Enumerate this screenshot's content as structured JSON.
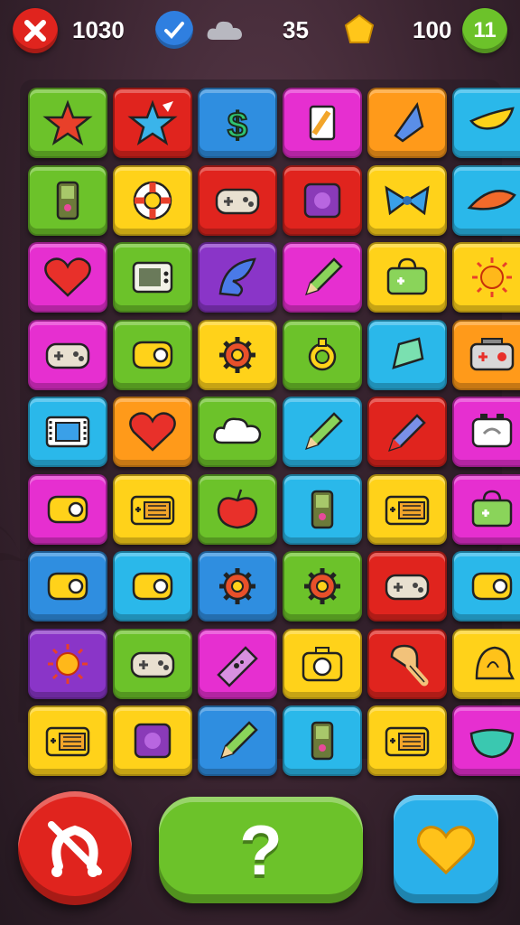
{
  "hud": {
    "close_icon": "close-x-icon",
    "coins": "1030",
    "avatar_icon": "checklist-icon",
    "cloud_icon": "cloud-icon",
    "moves": "35",
    "shape_icon": "gold-gem-icon",
    "score": "100",
    "pause_label": "11"
  },
  "colors": {
    "green": "#6cc22a",
    "red": "#e0241e",
    "blue": "#2f8ee0",
    "magenta": "#e62fd0",
    "orange": "#ff9a1a",
    "cyan": "#2ab8ea",
    "yellow": "#ffd21a",
    "purple": "#8a35c8"
  },
  "board": {
    "rows": [
      [
        {
          "c": "green",
          "i": "star"
        },
        {
          "c": "red",
          "i": "star-blue"
        },
        {
          "c": "blue",
          "i": "dollar"
        },
        {
          "c": "magenta",
          "i": "card"
        },
        {
          "c": "orange",
          "i": "kite"
        },
        {
          "c": "cyan",
          "i": "banana"
        }
      ],
      [
        {
          "c": "green",
          "i": "handheld"
        },
        {
          "c": "yellow",
          "i": "lifebuoy"
        },
        {
          "c": "red",
          "i": "gamepad"
        },
        {
          "c": "red",
          "i": "cartridge"
        },
        {
          "c": "yellow",
          "i": "bow"
        },
        {
          "c": "cyan",
          "i": "hat"
        }
      ],
      [
        {
          "c": "magenta",
          "i": "heart"
        },
        {
          "c": "green",
          "i": "tv"
        },
        {
          "c": "purple",
          "i": "leaf"
        },
        {
          "c": "magenta",
          "i": "pencil"
        },
        {
          "c": "yellow",
          "i": "bag"
        },
        {
          "c": "yellow",
          "i": "sun"
        }
      ],
      [
        {
          "c": "magenta",
          "i": "gamepad"
        },
        {
          "c": "green",
          "i": "controller"
        },
        {
          "c": "yellow",
          "i": "gear"
        },
        {
          "c": "green",
          "i": "ring"
        },
        {
          "c": "cyan",
          "i": "gem"
        },
        {
          "c": "orange",
          "i": "radio"
        }
      ],
      [
        {
          "c": "cyan",
          "i": "film"
        },
        {
          "c": "orange",
          "i": "heart"
        },
        {
          "c": "green",
          "i": "cloud"
        },
        {
          "c": "cyan",
          "i": "pencil"
        },
        {
          "c": "red",
          "i": "pen"
        },
        {
          "c": "magenta",
          "i": "battery"
        }
      ],
      [
        {
          "c": "magenta",
          "i": "controller"
        },
        {
          "c": "yellow",
          "i": "console"
        },
        {
          "c": "green",
          "i": "apple"
        },
        {
          "c": "cyan",
          "i": "handheld"
        },
        {
          "c": "yellow",
          "i": "console"
        },
        {
          "c": "magenta",
          "i": "bag"
        }
      ],
      [
        {
          "c": "blue",
          "i": "controller"
        },
        {
          "c": "cyan",
          "i": "controller"
        },
        {
          "c": "blue",
          "i": "gear"
        },
        {
          "c": "green",
          "i": "gear"
        },
        {
          "c": "red",
          "i": "gamepad"
        },
        {
          "c": "cyan",
          "i": "controller"
        }
      ],
      [
        {
          "c": "purple",
          "i": "sun"
        },
        {
          "c": "green",
          "i": "gamepad"
        },
        {
          "c": "magenta",
          "i": "bandage"
        },
        {
          "c": "yellow",
          "i": "camera"
        },
        {
          "c": "red",
          "i": "glove"
        },
        {
          "c": "yellow",
          "i": "bell"
        }
      ],
      [
        {
          "c": "yellow",
          "i": "console"
        },
        {
          "c": "yellow",
          "i": "cartridge"
        },
        {
          "c": "blue",
          "i": "pencil"
        },
        {
          "c": "cyan",
          "i": "handheld"
        },
        {
          "c": "yellow",
          "i": "console"
        },
        {
          "c": "magenta",
          "i": "bowl"
        }
      ]
    ]
  },
  "bottom": {
    "left_icon": "cancel-horseshoe-icon",
    "hint_label": "?",
    "right_icon": "heart-icon"
  }
}
